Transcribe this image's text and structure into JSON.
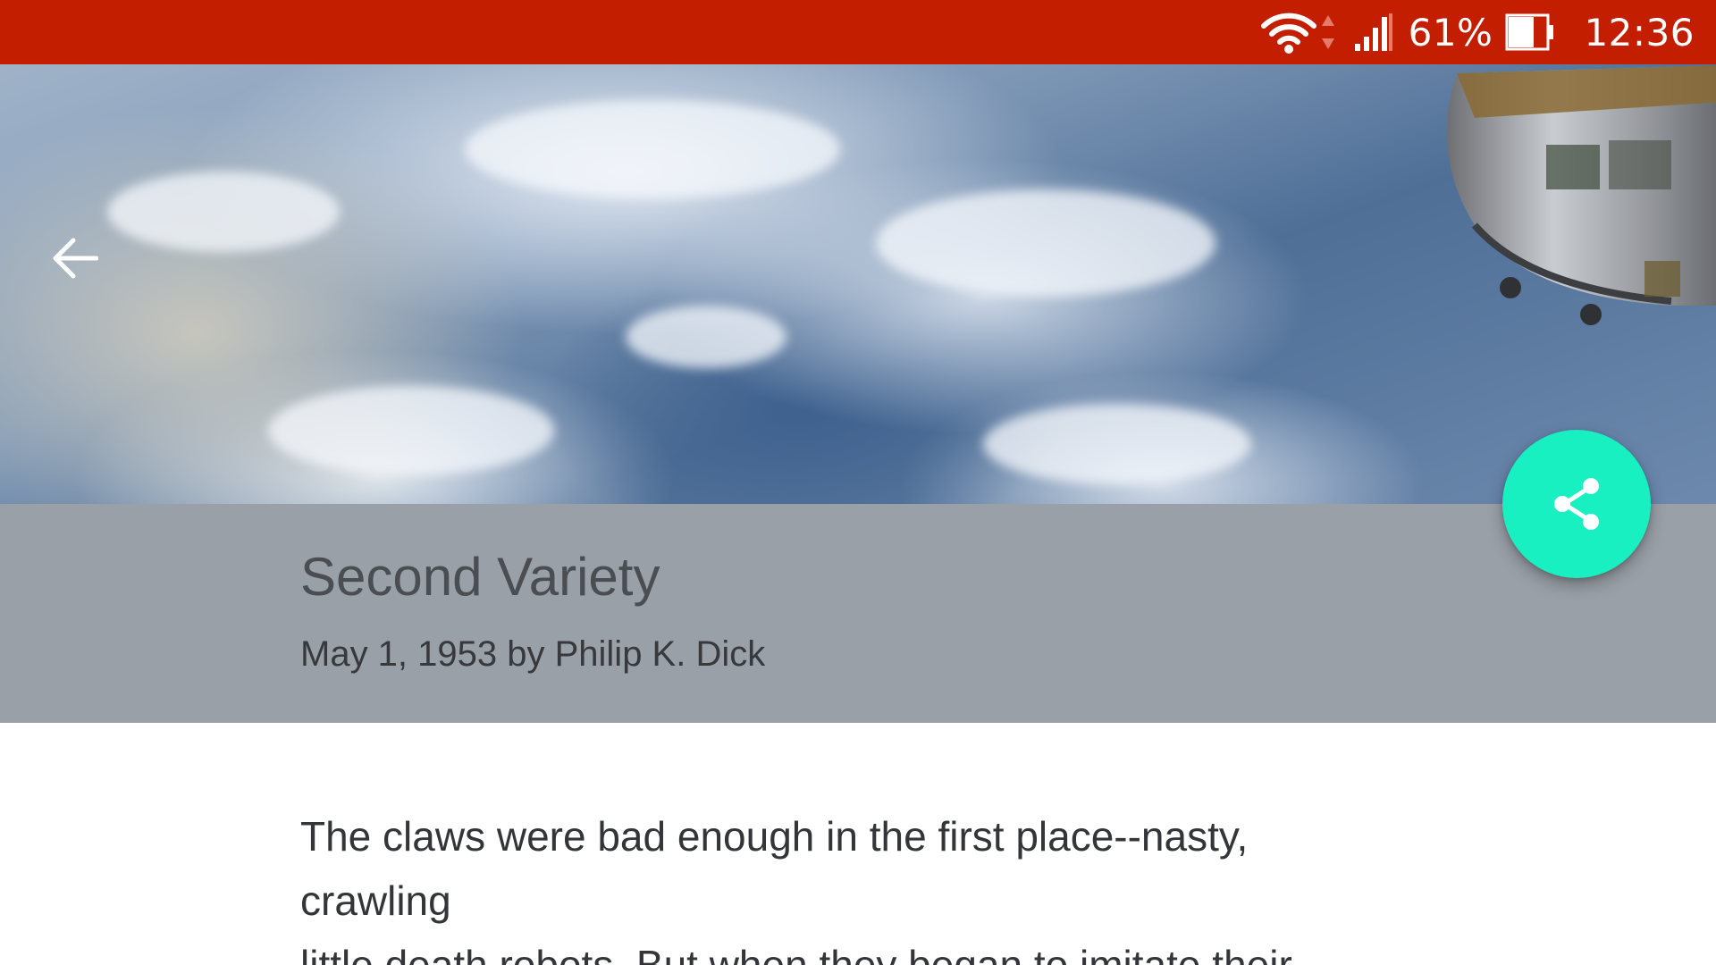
{
  "status_bar": {
    "battery_percent": "61%",
    "time": "12:36",
    "icons": [
      "wifi-icon",
      "data-arrows-icon",
      "cell-signal-icon",
      "battery-icon"
    ],
    "background_color": "#c41e00"
  },
  "hero": {
    "back_icon": "arrow-back-icon",
    "image_subject": "earth-from-space-with-station"
  },
  "story": {
    "title": "Second Variety",
    "meta": "May 1, 1953 by Philip K. Dick",
    "band_color": "#9aa0a8"
  },
  "fab": {
    "icon": "share-icon",
    "color": "#19f0c2"
  },
  "body": {
    "lines": [
      "The claws were bad enough in the first place--nasty,",
      "crawling",
      "little death robots. But when they began to imitate their"
    ]
  }
}
